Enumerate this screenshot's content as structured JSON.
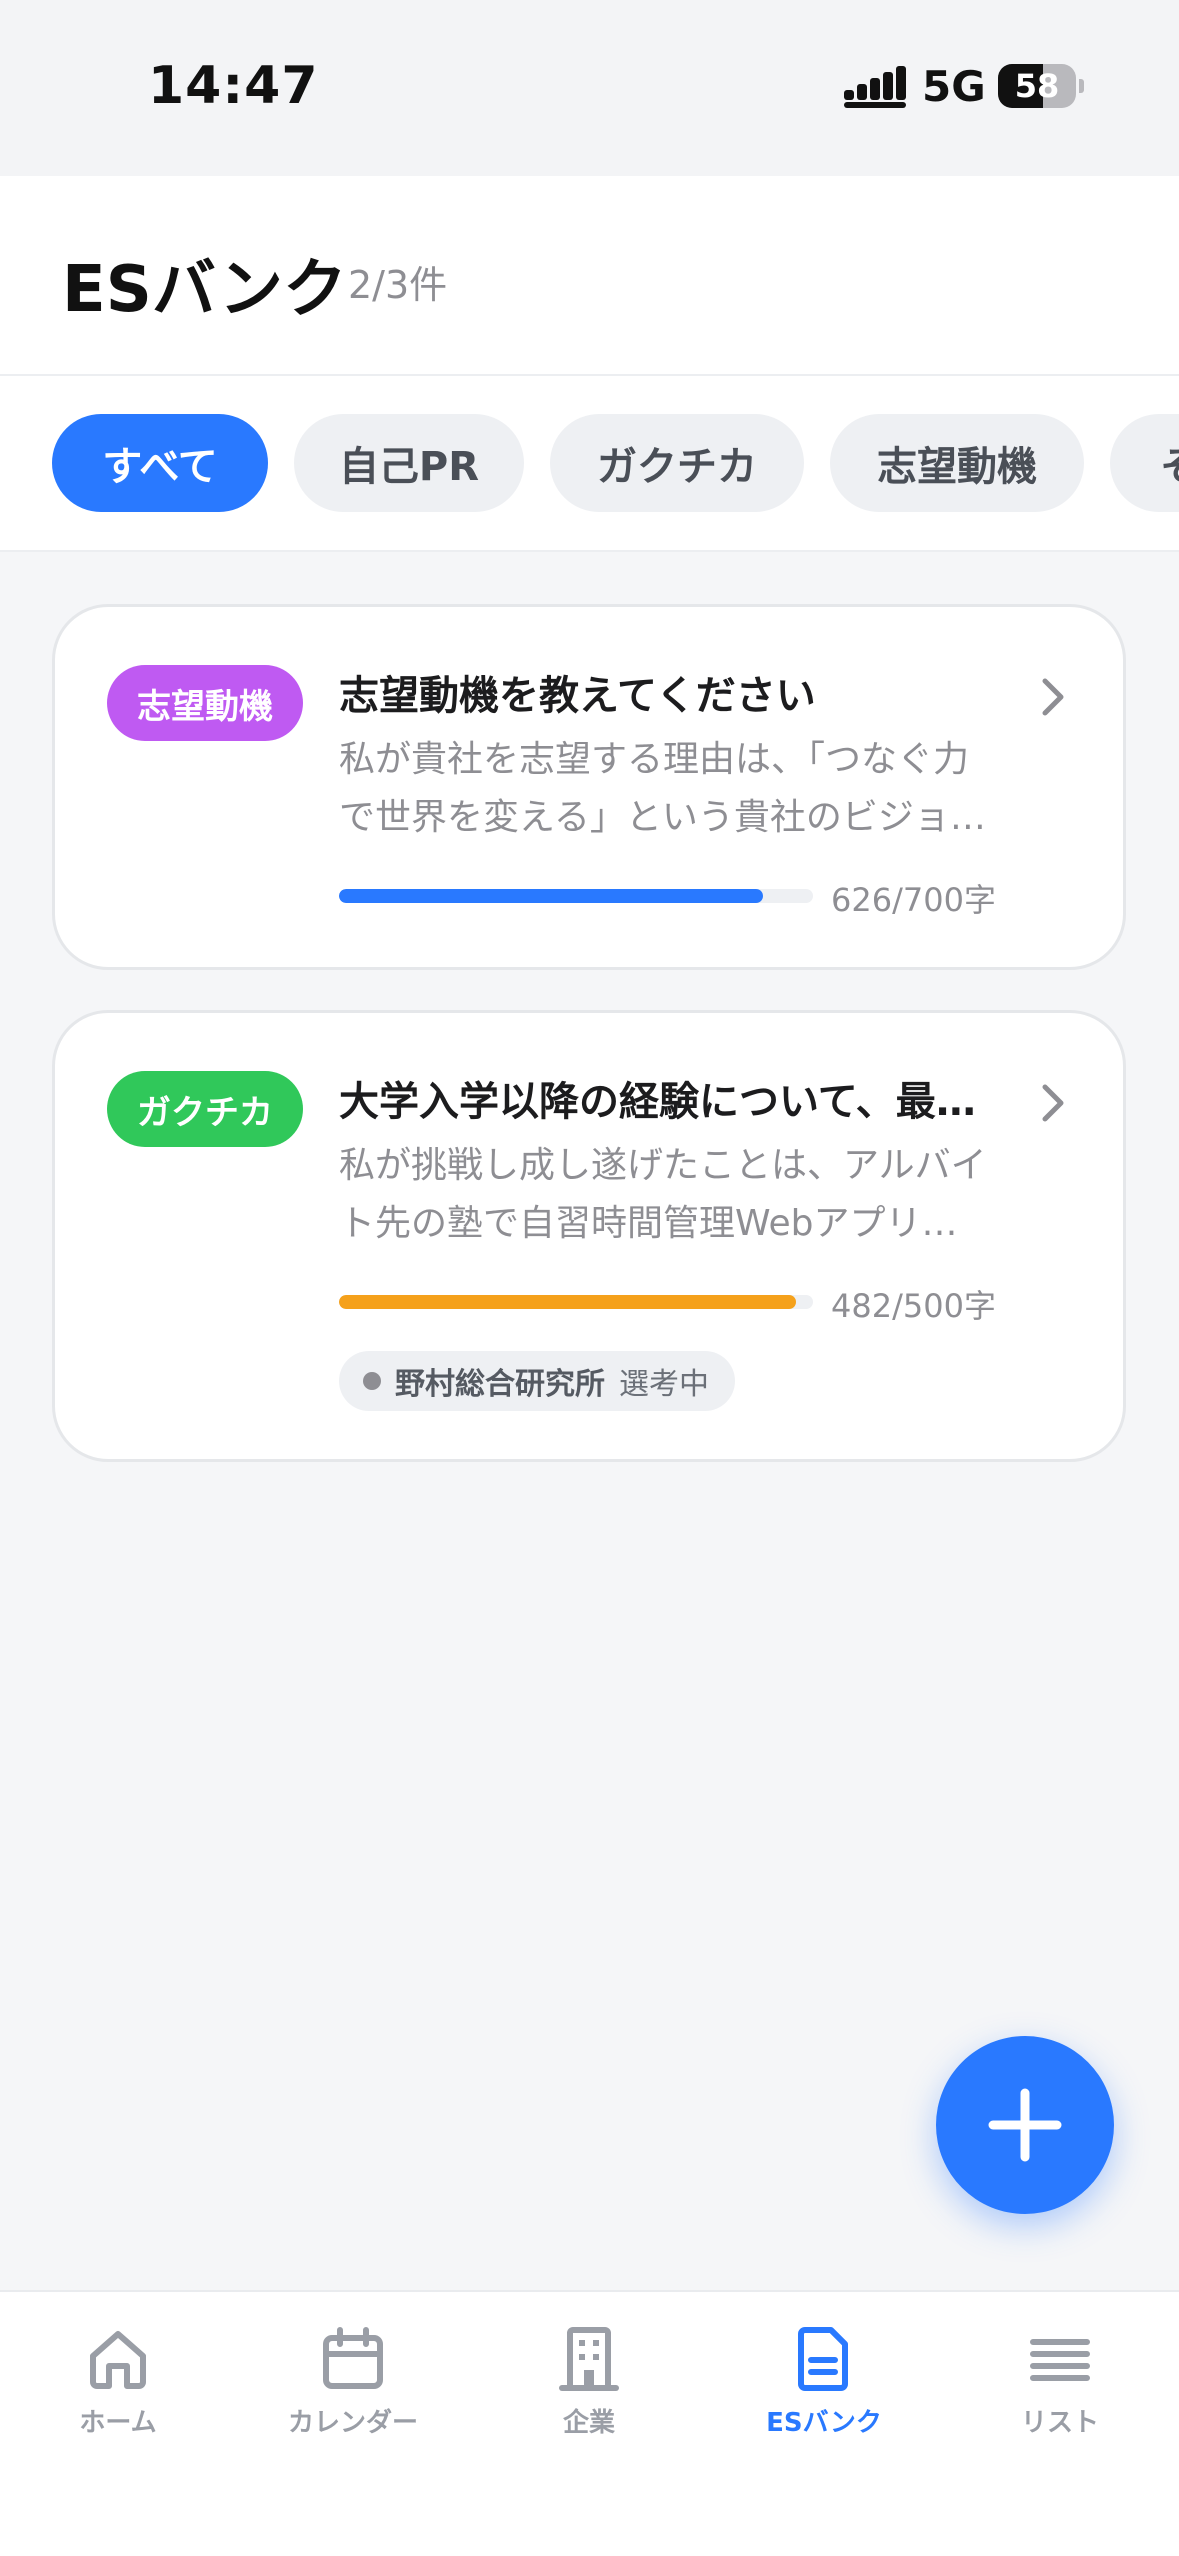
{
  "status_bar": {
    "time": "14:47",
    "network": "5G",
    "battery_percent": 58,
    "battery_label": "58"
  },
  "header": {
    "title": "ESバンク",
    "count": "2/3件"
  },
  "filters": [
    {
      "label": "すべて",
      "active": true
    },
    {
      "label": "自己PR",
      "active": false
    },
    {
      "label": "ガクチカ",
      "active": false
    },
    {
      "label": "志望動機",
      "active": false
    },
    {
      "label": "そ",
      "active": false
    }
  ],
  "cards": [
    {
      "tag": "志望動機",
      "tag_color": "#bf5af2",
      "title": "志望動機を教えてください",
      "excerpt": "私が貴社を志望する理由は、「つなぐ力で世界を変える」という貴社のビジョンに深く共感したからです。",
      "progress_color": "#2979ff",
      "chars_used": 626,
      "chars_limit": 700,
      "char_count": "626/700字"
    },
    {
      "tag": "ガクチカ",
      "tag_color": "#30c85a",
      "title": "大学入学以降の経験について、最も力を入れたことを教えてください",
      "excerpt": "私が挑戦し成し遂げたことは、アルバイト先の塾で自習時間管理Webアプリを開発したことです。",
      "progress_color": "#f5a11b",
      "chars_used": 482,
      "chars_limit": 500,
      "char_count": "482/500字",
      "company": {
        "name": "野村総合研究所",
        "status": "選考中"
      }
    }
  ],
  "nav": [
    {
      "label": "ホーム",
      "icon": "home-icon",
      "active": false
    },
    {
      "label": "カレンダー",
      "icon": "calendar-icon",
      "active": false
    },
    {
      "label": "企業",
      "icon": "building-icon",
      "active": false
    },
    {
      "label": "ESバンク",
      "icon": "document-icon",
      "active": true
    },
    {
      "label": "リスト",
      "icon": "list-icon",
      "active": false
    }
  ],
  "colors": {
    "accent": "#2979ff",
    "nav_inactive": "#9a9ea6"
  }
}
